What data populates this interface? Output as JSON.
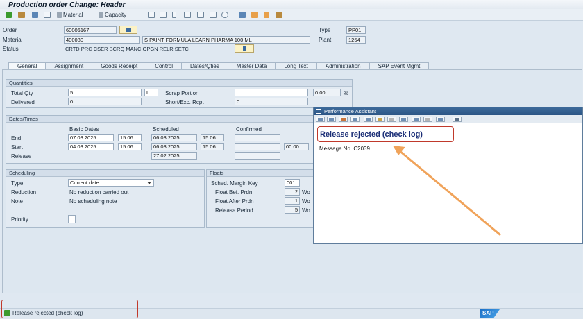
{
  "window": {
    "title": "Production order Change: Header"
  },
  "toolbar": {
    "material_label": "Material",
    "capacity_label": "Capacity"
  },
  "header": {
    "order_label": "Order",
    "order_value": "60006167",
    "type_label": "Type",
    "type_value": "PP01",
    "material_label": "Material",
    "material_value": "400080",
    "material_desc": "S PAINT FORMULA LEARN PHARMA 100 ML",
    "plant_label": "Plant",
    "plant_value": "1254",
    "status_label": "Status",
    "status_value": "CRTD PRC  CSER BCRQ MANC OPGN RELR SETC"
  },
  "tabs": [
    {
      "label": "General"
    },
    {
      "label": "Assignment"
    },
    {
      "label": "Goods Receipt"
    },
    {
      "label": "Control"
    },
    {
      "label": "Dates/Qties"
    },
    {
      "label": "Master Data"
    },
    {
      "label": "Long Text"
    },
    {
      "label": "Administration"
    },
    {
      "label": "SAP Event Mgmt"
    }
  ],
  "quantities": {
    "title": "Quantities",
    "total_qty_label": "Total Qty",
    "total_qty_value": "5",
    "unit": "L",
    "scrap_label": "Scrap Portion",
    "scrap_value": "",
    "scrap_pct": "0.00",
    "pct_sign": "%",
    "delivered_label": "Delivered",
    "delivered_value": "0",
    "short_label": "Short/Exc. Rcpt",
    "short_value": "0"
  },
  "dates": {
    "title": "Dates/Times",
    "basic_header": "Basic Dates",
    "scheduled_header": "Scheduled",
    "confirmed_header": "Confirmed",
    "end_label": "End",
    "end_basic_date": "07.03.2025",
    "end_basic_time": "15:06",
    "end_sched_date": "06.03.2025",
    "end_sched_time": "15:06",
    "start_label": "Start",
    "start_basic_date": "04.03.2025",
    "start_basic_time": "15:06",
    "start_sched_date": "06.03.2025",
    "start_sched_time": "15:06",
    "start_conf_time": "00:00",
    "release_label": "Release",
    "release_sched_date": "27.02.2025"
  },
  "scheduling": {
    "title": "Scheduling",
    "type_label": "Type",
    "type_value": "Current date",
    "reduction_label": "Reduction",
    "reduction_value": "No reduction carried out",
    "note_label": "Note",
    "note_value": "No scheduling note",
    "priority_label": "Priority"
  },
  "floats": {
    "title": "Floats",
    "margin_key_label": "Sched. Margin Key",
    "margin_key_value": "001",
    "float_before_label": "Float Bef. Prdn",
    "float_before_value": "2",
    "float_before_unit": "Wo",
    "float_after_label": "Float After Prdn",
    "float_after_value": "1",
    "float_after_unit": "Wo",
    "release_period_label": "Release Period",
    "release_period_value": "5",
    "release_period_unit": "Wo"
  },
  "performance_assistant": {
    "title": "Performance Assistant",
    "heading": "Release rejected (check log)",
    "message_no": "Message No. C2039"
  },
  "statusbar": {
    "message": "Release rejected (check log)",
    "logo": "SAP"
  },
  "colors": {
    "highlight": "#c0392b",
    "arrow": "#f0a35a",
    "heading": "#1c2f77"
  }
}
